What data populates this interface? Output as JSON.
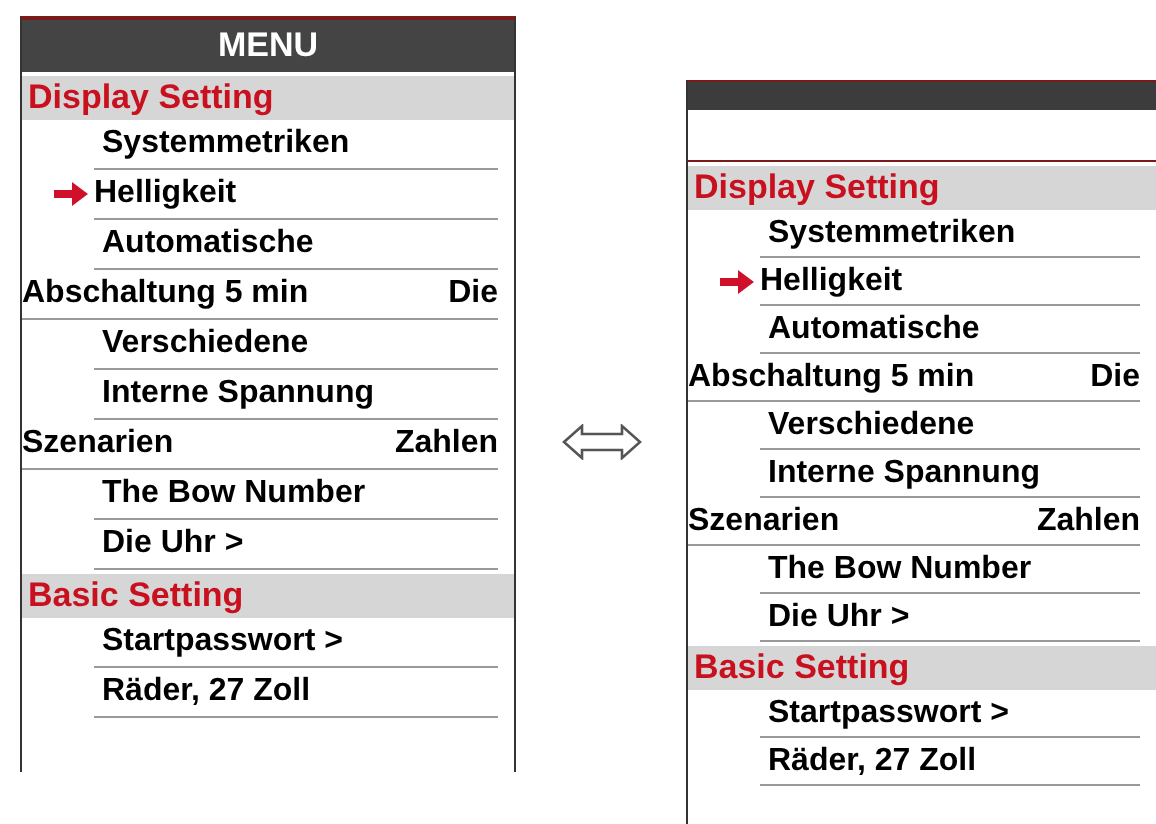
{
  "menus": [
    {
      "title": "MENU",
      "rows": [
        {
          "kind": "header",
          "label": "Display Setting"
        },
        {
          "kind": "item",
          "label": "Systemmetriken",
          "selected": false
        },
        {
          "kind": "item",
          "label": "Helligkeit",
          "selected": true
        },
        {
          "kind": "item",
          "label": "Automatische",
          "selected": false
        },
        {
          "kind": "pair",
          "left": "Abschaltung 5 min",
          "right": "Die"
        },
        {
          "kind": "item",
          "label": "Verschiedene",
          "selected": false
        },
        {
          "kind": "item",
          "label": "Interne Spannung",
          "selected": false
        },
        {
          "kind": "pair",
          "left": "Szenarien",
          "right": "Zahlen"
        },
        {
          "kind": "item",
          "label": "The Bow Number",
          "selected": false
        },
        {
          "kind": "item",
          "label": "Die Uhr >",
          "selected": false
        },
        {
          "kind": "header",
          "label": "Basic Setting"
        },
        {
          "kind": "item",
          "label": "Startpasswort >",
          "selected": false
        },
        {
          "kind": "item",
          "label": "Räder, 27 Zoll",
          "selected": false
        }
      ]
    },
    {
      "rows": [
        {
          "kind": "header",
          "label": "Display Setting"
        },
        {
          "kind": "item",
          "label": "Systemmetriken",
          "selected": false
        },
        {
          "kind": "item",
          "label": "Helligkeit",
          "selected": true
        },
        {
          "kind": "item",
          "label": "Automatische",
          "selected": false
        },
        {
          "kind": "pair",
          "left": "Abschaltung 5 min",
          "right": "Die"
        },
        {
          "kind": "item",
          "label": "Verschiedene",
          "selected": false
        },
        {
          "kind": "item",
          "label": "Interne Spannung",
          "selected": false
        },
        {
          "kind": "pair",
          "left": "Szenarien",
          "right": "Zahlen"
        },
        {
          "kind": "item",
          "label": "The Bow Number",
          "selected": false
        },
        {
          "kind": "item",
          "label": "Die Uhr >",
          "selected": false
        },
        {
          "kind": "header",
          "label": "Basic Setting"
        },
        {
          "kind": "item",
          "label": "Startpasswort >",
          "selected": false
        },
        {
          "kind": "item",
          "label": "Räder, 27 Zoll",
          "selected": false
        }
      ]
    }
  ]
}
